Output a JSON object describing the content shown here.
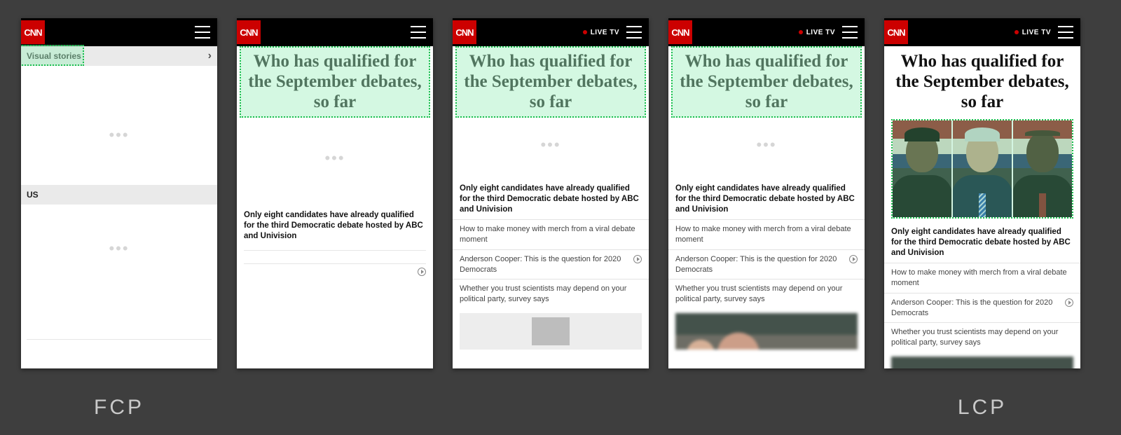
{
  "brand": "CNN",
  "live_label": "LIVE TV",
  "headline": "Who has qualified for the September debates, so far",
  "subhead": "Only eight candidates have already qualified for the third Democratic debate hosted by ABC and Univision",
  "stories": [
    {
      "text": "How to make money with merch from a viral debate moment",
      "video": false
    },
    {
      "text": "Anderson Cooper: This is the question for 2020 Democrats",
      "video": true
    },
    {
      "text": "Whether you trust scientists may depend on your political party, survey says",
      "video": false
    }
  ],
  "frame1": {
    "tab_label": "Visual stories",
    "section_label": "US"
  },
  "captions": {
    "fcp": "FCP",
    "lcp": "LCP"
  },
  "frames": [
    {
      "id": 1,
      "live_tv": false,
      "state": "initial",
      "highlight": "tab",
      "stories_shown": 0,
      "hero": "none",
      "bottom": "none",
      "caption": "fcp"
    },
    {
      "id": 2,
      "live_tv": false,
      "state": "headline",
      "highlight": "headline",
      "stories_shown": 0,
      "hero": "dots",
      "bottom": "none",
      "caption": null
    },
    {
      "id": 3,
      "live_tv": true,
      "state": "list",
      "highlight": "headline",
      "stories_shown": 3,
      "hero": "dots",
      "bottom": "loader",
      "caption": null
    },
    {
      "id": 4,
      "live_tv": true,
      "state": "list-bottom-image",
      "highlight": "headline",
      "stories_shown": 3,
      "hero": "dots",
      "bottom": "image",
      "caption": null
    },
    {
      "id": 5,
      "live_tv": true,
      "state": "hero-loaded",
      "highlight": "hero",
      "stories_shown": 3,
      "hero": "photos",
      "bottom": "image",
      "caption": "lcp"
    }
  ]
}
